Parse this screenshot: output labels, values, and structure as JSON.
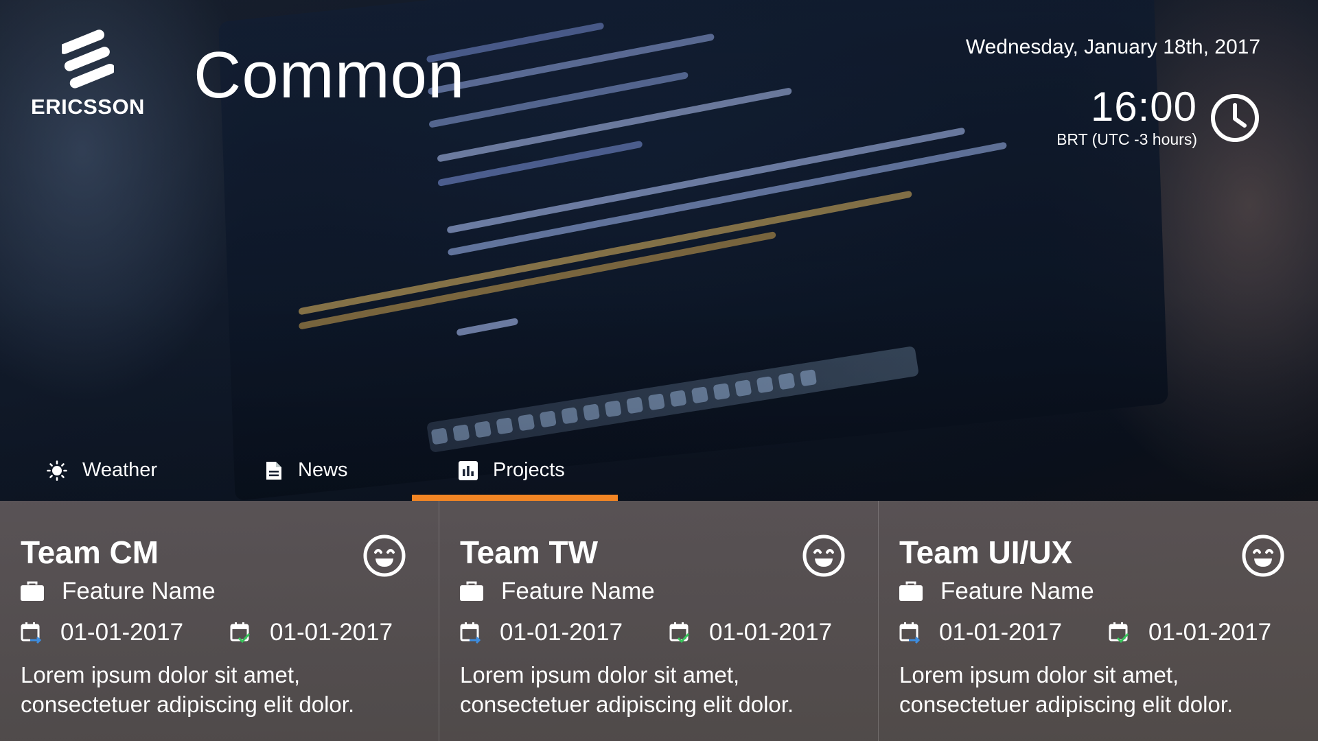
{
  "brand": {
    "name": "ERICSSON",
    "logo_icon": "ericsson-logo"
  },
  "page": {
    "title": "Common"
  },
  "datetime": {
    "date": "Wednesday, January 18th, 2017",
    "time": "16:00",
    "timezone": "BRT (UTC -3 hours)",
    "icon": "clock-icon"
  },
  "tabs": [
    {
      "label": "Weather",
      "icon": "sun-icon",
      "active": false
    },
    {
      "label": "News",
      "icon": "document-icon",
      "active": false
    },
    {
      "label": "Projects",
      "icon": "bar-chart-icon",
      "active": true
    }
  ],
  "accent_color": "#f28524",
  "cards": [
    {
      "team": "Team CM",
      "mood_icon": "smiley-icon",
      "feature": "Feature Name",
      "start_date": "01-01-2017",
      "end_date": "01-01-2017",
      "description": "Lorem ipsum dolor sit amet, consectetuer adipiscing elit dolor."
    },
    {
      "team": "Team TW",
      "mood_icon": "smiley-icon",
      "feature": "Feature Name",
      "start_date": "01-01-2017",
      "end_date": "01-01-2017",
      "description": "Lorem ipsum dolor sit amet, consectetuer adipiscing elit dolor."
    },
    {
      "team": "Team UI/UX",
      "mood_icon": "smiley-icon",
      "feature": "Feature Name",
      "start_date": "01-01-2017",
      "end_date": "01-01-2017",
      "description": "Lorem ipsum dolor sit amet, consectetuer adipiscing elit dolor."
    }
  ]
}
